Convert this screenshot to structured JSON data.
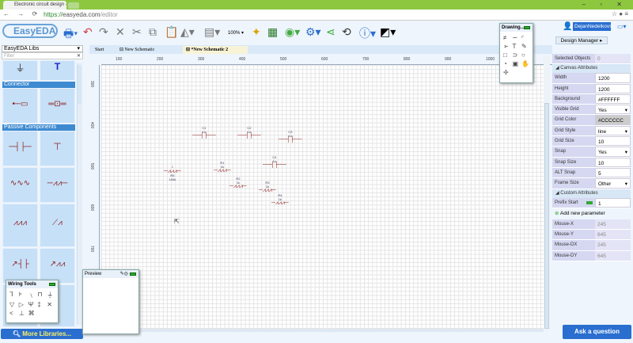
{
  "browser": {
    "tab_title": "Electronic circuit design -",
    "url_scheme": "https://",
    "url_host": "easyeda.com",
    "url_path": "/editor"
  },
  "toolbar": {
    "logo": "EasyEDA",
    "zoom": "100%"
  },
  "user": {
    "name": "DejanNedelkovs"
  },
  "library": {
    "selected": "EasyEDA Libs",
    "filter_placeholder": "Filter",
    "categories": [
      "Connector",
      "Passive Components"
    ],
    "more_button": "More Libraries..."
  },
  "doc_tabs": [
    {
      "label": "Start"
    },
    {
      "label": "New Schematic"
    },
    {
      "label": "*New Schematic 2"
    }
  ],
  "ruler": {
    "top": [
      "100",
      "200",
      "300",
      "400",
      "500",
      "600",
      "700",
      "800",
      "900",
      "1000"
    ],
    "left": [
      "300",
      "400",
      "500",
      "600",
      "700"
    ]
  },
  "parts": [
    {
      "ref": "C1",
      "val": "1u"
    },
    {
      "ref": "C2",
      "val": "1u"
    },
    {
      "ref": "C3",
      "val": "1u"
    },
    {
      "ref": "C4",
      "val": "1u"
    },
    {
      "ref": "R1",
      "val": "1k"
    },
    {
      "ref": "R2",
      "val": "1k"
    },
    {
      "ref": "R3",
      "val": "1k"
    },
    {
      "ref": "R4",
      "val": "1k"
    },
    {
      "ref": "R5",
      "val": "100k"
    }
  ],
  "drawing_tools": {
    "title": "Drawing..."
  },
  "wiring_tools": {
    "title": "Wiring Tools"
  },
  "preview": {
    "title": "Preview"
  },
  "right_panel": {
    "design_manager": "Design Manager ▸",
    "selected_objects": {
      "label": "Selected Objects",
      "value": "0"
    },
    "canvas_title": "Canvas Attributes",
    "canvas": [
      {
        "label": "Width",
        "value": "1200"
      },
      {
        "label": "Height",
        "value": "1200"
      },
      {
        "label": "Background",
        "value": "#FFFFFF"
      },
      {
        "label": "Visible Grid",
        "value": "Yes",
        "select": true
      },
      {
        "label": "Grid Color",
        "value": "#CCCCCC"
      },
      {
        "label": "Grid Style",
        "value": "line",
        "select": true
      },
      {
        "label": "Grid Size",
        "value": "10"
      },
      {
        "label": "Snap",
        "value": "Yes",
        "select": true
      },
      {
        "label": "Snap Size",
        "value": "10"
      },
      {
        "label": "ALT Snap",
        "value": "5"
      },
      {
        "label": "Frame Size",
        "value": "Other",
        "select": true
      }
    ],
    "custom_title": "Custom Attributes",
    "prefix": {
      "label": "Prefix Start",
      "value": "1"
    },
    "add_param": "Add new parameter",
    "mouse": [
      {
        "label": "Mouse-X",
        "value": "245"
      },
      {
        "label": "Mouse-Y",
        "value": "645"
      },
      {
        "label": "Mouse-DX",
        "value": "245"
      },
      {
        "label": "Mouse-DY",
        "value": "645"
      }
    ],
    "ask": "Ask a question"
  },
  "colors": {
    "accent": "#2a6fd0",
    "chrome": "#8dc63f",
    "part": "#8b1a1a",
    "category": "#3d8ad1"
  }
}
